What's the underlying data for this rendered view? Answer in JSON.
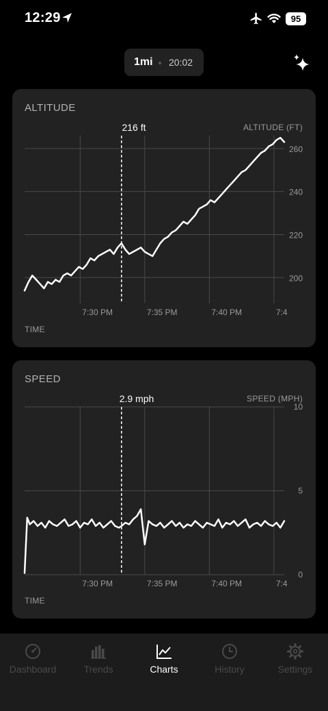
{
  "status": {
    "time": "12:29",
    "battery": "95"
  },
  "route": {
    "distance": "1mi",
    "duration": "20:02"
  },
  "altitude": {
    "title": "ALTITUDE",
    "selection_label": "216 ft",
    "xlabel": "TIME",
    "ylabel": "ALTITUDE (FT)"
  },
  "speed": {
    "title": "SPEED",
    "selection_label": "2.9 mph",
    "xlabel": "TIME",
    "ylabel": "SPEED (MPH)"
  },
  "tabs": [
    {
      "label": "Dashboard",
      "icon": "gauge-icon",
      "active": false
    },
    {
      "label": "Trends",
      "icon": "bar-chart-icon",
      "active": false
    },
    {
      "label": "Charts",
      "icon": "line-chart-icon",
      "active": true
    },
    {
      "label": "History",
      "icon": "clock-icon",
      "active": false
    },
    {
      "label": "Settings",
      "icon": "gear-icon",
      "active": false
    }
  ],
  "colors": {
    "background": "#000000",
    "card": "#222222",
    "line": "#ffffff",
    "grid": "#4a4a4a"
  },
  "chart_data": [
    {
      "type": "line",
      "title": "ALTITUDE",
      "xlabel": "TIME",
      "ylabel": "ALTITUDE (FT)",
      "x_ticks": [
        "7:30 PM",
        "7:35 PM",
        "7:40 PM",
        "7:4"
      ],
      "x_tick_minutes": [
        30,
        35,
        40,
        45
      ],
      "y_ticks": [
        200,
        220,
        240,
        260
      ],
      "xlim": [
        25.7,
        45.8
      ],
      "ylim": [
        188,
        266
      ],
      "selection": {
        "minute": 33.2,
        "label": "216 ft"
      },
      "series": [
        {
          "x": [
            25.7,
            26.0,
            26.3,
            26.6,
            26.9,
            27.2,
            27.5,
            27.8,
            28.1,
            28.4,
            28.7,
            29.0,
            29.3,
            29.6,
            29.9,
            30.2,
            30.5,
            30.8,
            31.1,
            31.4,
            31.7,
            32.0,
            32.3,
            32.6,
            32.9,
            33.2,
            33.5,
            33.8,
            34.1,
            34.4,
            34.7,
            35.0,
            35.3,
            35.6,
            35.9,
            36.2,
            36.5,
            36.8,
            37.1,
            37.4,
            37.7,
            38.0,
            38.3,
            38.6,
            38.9,
            39.2,
            39.5,
            39.8,
            40.1,
            40.4,
            40.7,
            41.0,
            41.3,
            41.6,
            41.9,
            42.2,
            42.5,
            42.8,
            43.1,
            43.4,
            43.7,
            44.0,
            44.3,
            44.6,
            44.9,
            45.2,
            45.5,
            45.8
          ],
          "y": [
            194,
            198,
            201,
            199,
            197,
            195,
            198,
            197,
            199,
            198,
            201,
            202,
            201,
            203,
            205,
            204,
            206,
            209,
            208,
            210,
            211,
            212,
            213,
            211,
            214,
            216,
            213,
            211,
            212,
            213,
            214,
            212,
            211,
            210,
            213,
            216,
            218,
            219,
            221,
            222,
            224,
            226,
            225,
            227,
            229,
            232,
            233,
            234,
            236,
            235,
            237,
            239,
            241,
            243,
            245,
            247,
            249,
            250,
            252,
            254,
            256,
            258,
            259,
            261,
            262,
            264,
            265,
            263
          ]
        }
      ]
    },
    {
      "type": "line",
      "title": "SPEED",
      "xlabel": "TIME",
      "ylabel": "SPEED (MPH)",
      "x_ticks": [
        "7:30 PM",
        "7:35 PM",
        "7:40 PM",
        "7:4"
      ],
      "x_tick_minutes": [
        30,
        35,
        40,
        45
      ],
      "y_ticks": [
        0,
        5,
        10
      ],
      "xlim": [
        25.7,
        45.8
      ],
      "ylim": [
        0,
        10
      ],
      "selection": {
        "minute": 33.2,
        "label": "2.9 mph"
      },
      "series": [
        {
          "x": [
            25.7,
            25.9,
            26.1,
            26.4,
            26.7,
            27.0,
            27.3,
            27.6,
            27.9,
            28.2,
            28.5,
            28.8,
            29.1,
            29.4,
            29.7,
            30.0,
            30.3,
            30.6,
            30.9,
            31.2,
            31.5,
            31.8,
            32.1,
            32.4,
            32.7,
            33.0,
            33.2,
            33.5,
            33.8,
            34.1,
            34.4,
            34.7,
            35.0,
            35.3,
            35.6,
            35.9,
            36.2,
            36.5,
            36.8,
            37.1,
            37.4,
            37.7,
            38.0,
            38.3,
            38.6,
            38.9,
            39.2,
            39.5,
            39.8,
            40.1,
            40.4,
            40.7,
            41.0,
            41.3,
            41.6,
            41.9,
            42.2,
            42.5,
            42.8,
            43.1,
            43.4,
            43.7,
            44.0,
            44.3,
            44.6,
            44.9,
            45.2,
            45.5,
            45.8
          ],
          "y": [
            0.1,
            3.4,
            3.0,
            3.2,
            2.9,
            3.1,
            2.8,
            3.2,
            3.0,
            2.9,
            3.1,
            3.3,
            2.9,
            3.0,
            3.2,
            2.8,
            3.1,
            3.0,
            3.3,
            2.9,
            3.1,
            2.8,
            3.0,
            3.2,
            2.9,
            2.8,
            2.9,
            3.1,
            3.0,
            3.3,
            3.5,
            3.9,
            1.8,
            3.2,
            3.0,
            2.9,
            3.1,
            2.8,
            3.0,
            3.2,
            2.9,
            3.1,
            2.8,
            3.0,
            2.9,
            3.2,
            3.0,
            2.8,
            3.1,
            3.0,
            2.9,
            3.3,
            2.8,
            3.1,
            3.0,
            3.2,
            2.9,
            3.1,
            3.3,
            2.8,
            3.0,
            3.1,
            2.9,
            3.2,
            3.0,
            2.9,
            3.1,
            2.8,
            3.2
          ]
        }
      ]
    }
  ]
}
